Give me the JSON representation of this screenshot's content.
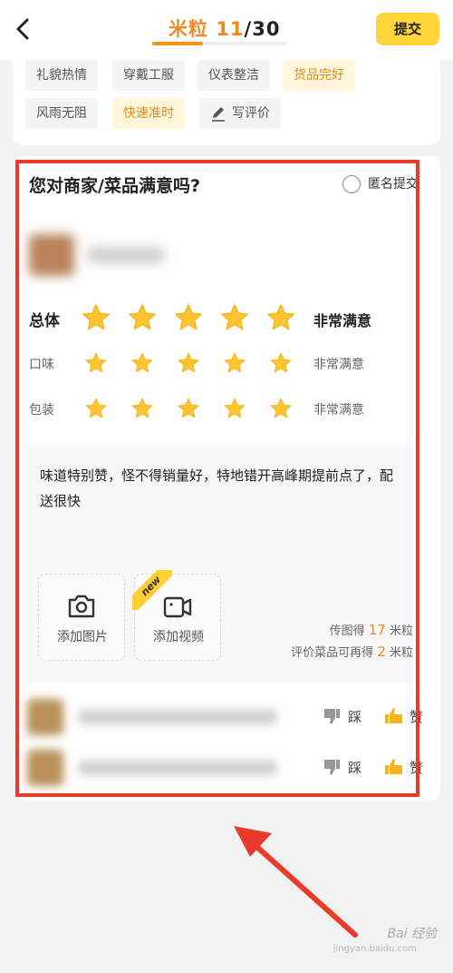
{
  "header": {
    "title_prefix": "米粒 ",
    "current": "11",
    "slash": "/",
    "total": "30",
    "progress": 0.37,
    "submit_label": "提交"
  },
  "tags": [
    {
      "label": "礼貌热情",
      "selected": false
    },
    {
      "label": "穿戴工服",
      "selected": false
    },
    {
      "label": "仪表整洁",
      "selected": false
    },
    {
      "label": "货品完好",
      "selected": true
    },
    {
      "label": "风雨无阻",
      "selected": false
    },
    {
      "label": "快速准时",
      "selected": true
    },
    {
      "label": "写评价",
      "selected": false,
      "icon": "pencil-icon"
    }
  ],
  "review": {
    "question": "您对商家/菜品满意吗?",
    "anonymous_label": "匿名提交",
    "rows": [
      {
        "label": "总体",
        "stars": 5,
        "value": "非常满意"
      },
      {
        "label": "口味",
        "stars": 5,
        "value": "非常满意"
      },
      {
        "label": "包装",
        "stars": 5,
        "value": "非常满意"
      }
    ],
    "comment": "味道特别赞，怪不得销量好，特地错开高峰期提前点了，配送很快",
    "add_photo_label": "添加图片",
    "add_video_label": "添加视频",
    "new_badge": "new",
    "reward_photo": {
      "prefix": "传图得 ",
      "num": "17",
      "suffix": " 米粒"
    },
    "reward_dish": {
      "prefix": "评价菜品可再得 ",
      "num": "2",
      "suffix": " 米粒"
    }
  },
  "dishes": [
    {
      "dislike_label": "踩",
      "like_label": "赞"
    },
    {
      "dislike_label": "踩",
      "like_label": "赞"
    }
  ],
  "watermark": {
    "line1": "Bai 经验",
    "line2": "jingyan.baidu.com"
  },
  "colors": {
    "accent": "#f08a24",
    "star": "#ffc531",
    "annotation": "#ea3a2a",
    "submit_bg": "#ffd53a"
  }
}
